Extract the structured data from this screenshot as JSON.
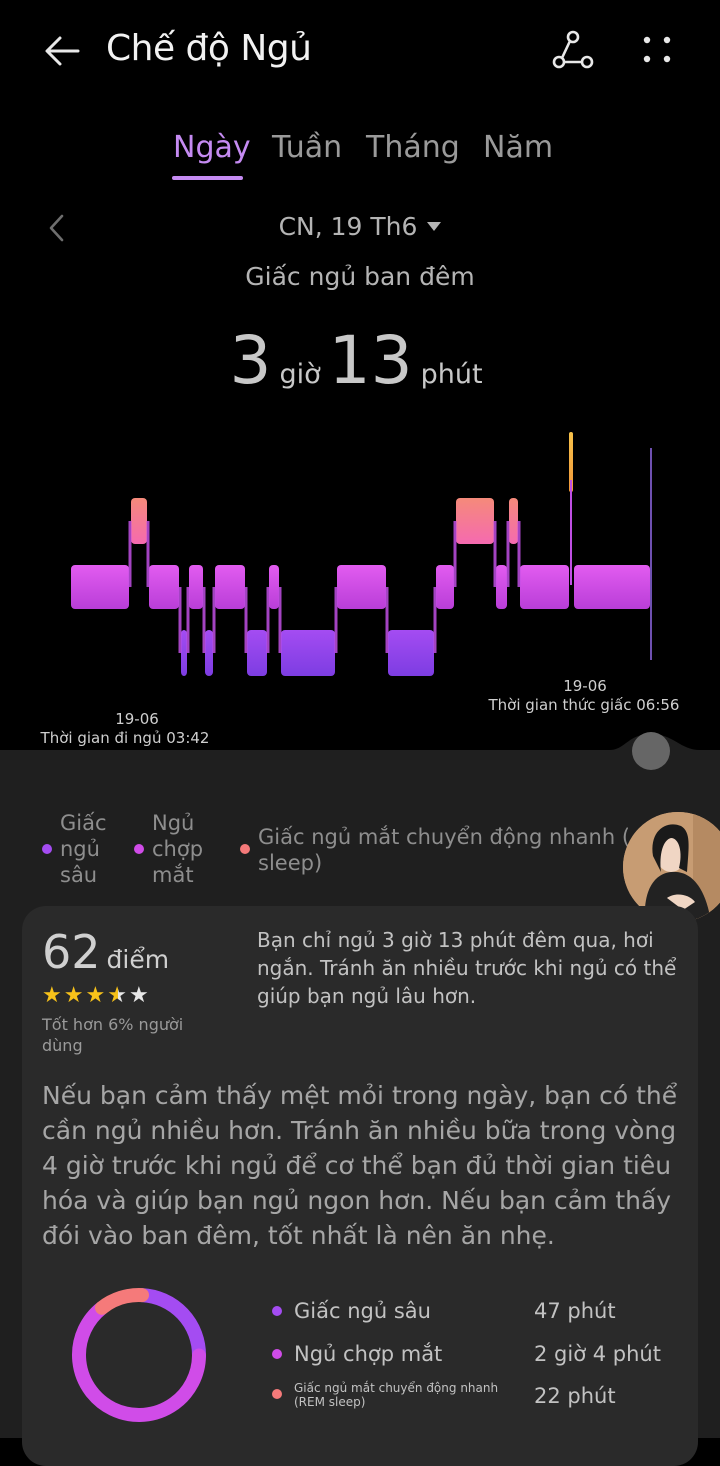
{
  "header": {
    "title": "Chế độ Ngủ",
    "share_icon": "share-nodes-icon",
    "more_icon": "more-dots-icon",
    "back_icon": "back-arrow-icon"
  },
  "tabs": [
    {
      "label": "Ngày",
      "active": true
    },
    {
      "label": "Tuần",
      "active": false
    },
    {
      "label": "Tháng",
      "active": false
    },
    {
      "label": "Năm",
      "active": false
    }
  ],
  "date": {
    "label": "CN, 19 Th6",
    "sleep_type": "Giấc ngủ ban đêm"
  },
  "duration": {
    "hours": "3",
    "hours_unit": "giờ",
    "minutes": "13",
    "minutes_unit": "phút"
  },
  "chart_data": {
    "type": "area",
    "stages": [
      "REM",
      "Ngủ chợp mắt",
      "Giấc ngủ sâu"
    ],
    "sleep_start": {
      "date": "19-06",
      "label": "Thời gian đi ngủ 03:42"
    },
    "wake": {
      "date": "19-06",
      "label": "Thời gian thức giấc 06:56"
    },
    "colors": {
      "deep": "#9b4cf2",
      "light": "#d04ce8",
      "rem": "#f57a7a",
      "awake": "#f5b24a"
    }
  },
  "legend": [
    {
      "label": "Giấc ngủ sâu",
      "lines": [
        "Giấc",
        "ngủ",
        "sâu"
      ],
      "color": "#a44cf2"
    },
    {
      "label": "Ngủ chợp mắt",
      "lines": [
        "Ngủ",
        "chợp",
        "mắt"
      ],
      "color": "#d04ce8"
    },
    {
      "label": "Giấc ngủ mắt chuyển động nhanh (REM sleep)",
      "lines": [
        "Giấc ngủ mắt chuyển động nhanh (REM",
        "sleep)"
      ],
      "color": "#f57a7a"
    }
  ],
  "score": {
    "value": "62",
    "unit": "điểm",
    "stars": 3.5,
    "stars_max": 5,
    "better_than": "Tốt hơn 6% người dùng"
  },
  "summary": "Bạn chỉ ngủ 3 giờ 13 phút đêm qua, hơi ngắn. Tránh ăn nhiều trước khi ngủ có thể giúp bạn ngủ lâu hơn.",
  "advice": "Nếu bạn cảm thấy mệt mỏi trong ngày, bạn có thể cần ngủ nhiều hơn. Tránh ăn nhiều bữa trong vòng 4 giờ trước khi ngủ để cơ thể bạn đủ thời gian tiêu hóa và giúp bạn ngủ ngon hơn. Nếu bạn cảm thấy đói vào ban đêm, tốt nhất là nên ăn nhẹ.",
  "breakdown": [
    {
      "label": "Giấc ngủ sâu",
      "value": "47 phút",
      "color": "#a44cf2"
    },
    {
      "label": "Ngủ chợp mắt",
      "value": "2 giờ 4 phút",
      "color": "#d04ce8"
    },
    {
      "label": "Giấc ngủ mắt chuyển động nhanh (REM sleep)",
      "value": "22 phút",
      "color": "#f57a7a"
    }
  ]
}
